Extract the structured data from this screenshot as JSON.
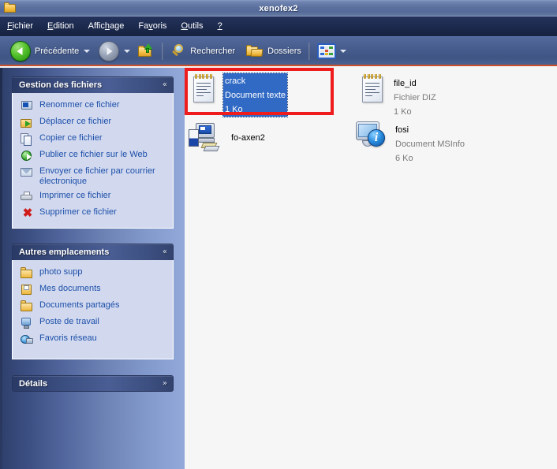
{
  "window": {
    "title": "xenofex2",
    "icon": "folder-icon"
  },
  "menubar": {
    "items": [
      {
        "label": "Fichier",
        "accel": "F"
      },
      {
        "label": "Edition",
        "accel": "E"
      },
      {
        "label": "Affichage",
        "accel": "h"
      },
      {
        "label": "Favoris",
        "accel": "v"
      },
      {
        "label": "Outils",
        "accel": "O"
      },
      {
        "label": "?",
        "accel": "?"
      }
    ]
  },
  "toolbar": {
    "back_label": "Précédente",
    "search_label": "Rechercher",
    "folders_label": "Dossiers",
    "back_icon": "back-arrow-icon",
    "forward_icon": "forward-arrow-icon",
    "up_icon": "up-folder-icon",
    "search_icon": "search-icon",
    "folders_icon": "folders-icon",
    "views_icon": "views-icon"
  },
  "sidebar": {
    "panels": [
      {
        "title": "Gestion des fichiers",
        "chevron": "«",
        "collapsed": false,
        "items": [
          {
            "label": "Renommer ce fichier",
            "icon": "rename-icon"
          },
          {
            "label": "Déplacer ce fichier",
            "icon": "move-icon"
          },
          {
            "label": "Copier ce fichier",
            "icon": "copy-icon"
          },
          {
            "label": "Publier ce fichier sur le Web",
            "icon": "web-publish-icon"
          },
          {
            "label": "Envoyer ce fichier par courrier électronique",
            "icon": "mail-icon"
          },
          {
            "label": "Imprimer ce fichier",
            "icon": "print-icon"
          },
          {
            "label": "Supprimer ce fichier",
            "icon": "delete-icon"
          }
        ]
      },
      {
        "title": "Autres emplacements",
        "chevron": "«",
        "collapsed": false,
        "items": [
          {
            "label": "photo supp",
            "icon": "folder-icon"
          },
          {
            "label": "Mes documents",
            "icon": "my-documents-icon"
          },
          {
            "label": "Documents partagés",
            "icon": "folder-icon"
          },
          {
            "label": "Poste de travail",
            "icon": "computer-icon"
          },
          {
            "label": "Favoris réseau",
            "icon": "network-icon"
          }
        ]
      },
      {
        "title": "Détails",
        "chevron": "»",
        "collapsed": true,
        "items": []
      }
    ]
  },
  "content": {
    "files": [
      {
        "name": "crack",
        "type": "Document texte",
        "size": "1 Ko",
        "icon": "text-document-icon",
        "selected": true
      },
      {
        "name": "file_id",
        "type": "Fichier DIZ",
        "size": "1 Ko",
        "icon": "text-document-icon",
        "selected": false
      },
      {
        "name": "fo-axen2",
        "type": "",
        "size": "",
        "icon": "setup-application-icon",
        "selected": false
      },
      {
        "name": "fosi",
        "type": "Document MSInfo",
        "size": "6 Ko",
        "icon": "msinfo-document-icon",
        "selected": false,
        "badge_glyph": "i"
      }
    ]
  },
  "annotation": {
    "type": "red-highlight-rectangle",
    "color": "#ee1c1c",
    "target": "crack"
  },
  "colors": {
    "titlebar": "#5d729f",
    "menubar": "#1c2a4e",
    "toolbar": "#475d8e",
    "sidebar_gradient_start": "#2e3f6b",
    "sidebar_gradient_end": "#93a9da",
    "panel_body": "#d2d9ef",
    "link": "#1c4fa8",
    "content_bg": "#f6f6f6",
    "selection": "#316ac5",
    "annotation": "#ee1c1c"
  }
}
